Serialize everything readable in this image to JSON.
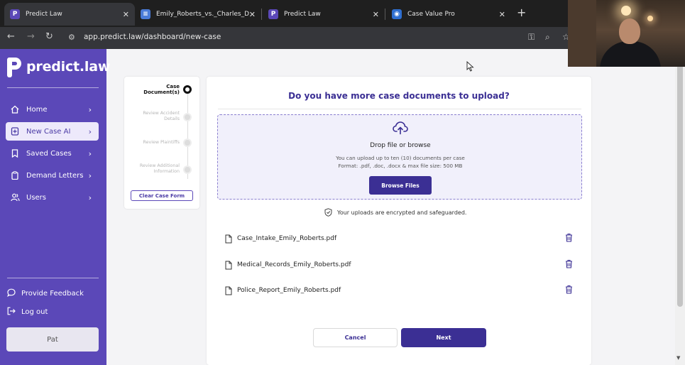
{
  "browser": {
    "tabs": [
      {
        "title": "Predict Law",
        "active": true
      },
      {
        "title": "Emily_Roberts_vs._Charles_D._M",
        "active": false
      },
      {
        "title": "Predict Law",
        "active": false
      },
      {
        "title": "Case Value Pro",
        "active": false
      }
    ],
    "url": "app.predict.law/dashboard/new-case"
  },
  "sidebar": {
    "logo": "predict.law",
    "items": [
      {
        "label": "Home",
        "icon": "home-icon",
        "active": false
      },
      {
        "label": "New Case AI",
        "icon": "new-case-icon",
        "active": true
      },
      {
        "label": "Saved Cases",
        "icon": "bookmark-icon",
        "active": false
      },
      {
        "label": "Demand Letters",
        "icon": "clipboard-icon",
        "active": false
      },
      {
        "label": "Users",
        "icon": "users-icon",
        "active": false
      }
    ],
    "feedback": "Provide Feedback",
    "logout": "Log out",
    "user": "Pat"
  },
  "stepper": {
    "steps": [
      {
        "label": "Case Document(s)",
        "current": true
      },
      {
        "label": "Review Accident Details",
        "current": false
      },
      {
        "label": "Review Plaintiffs",
        "current": false
      },
      {
        "label": "Review Additional Information",
        "current": false
      }
    ],
    "clear_label": "Clear Case Form"
  },
  "upload": {
    "heading": "Do you have more case documents to upload?",
    "drop_title": "Drop file or browse",
    "limit_text": "You can upload up to ten (10) documents per case",
    "format_text": "Format: .pdf, .doc, .docx & max file size: 500 MB",
    "browse_label": "Browse Files",
    "secure_text": "Your uploads are encrypted and safeguarded."
  },
  "files": [
    {
      "name": "Case_Intake_Emily_Roberts.pdf"
    },
    {
      "name": "Medical_Records_Emily_Roberts.pdf"
    },
    {
      "name": "Police_Report_Emily_Roberts.pdf"
    }
  ],
  "actions": {
    "cancel": "Cancel",
    "next": "Next"
  },
  "colors": {
    "sidebar": "#5b48b8",
    "primary": "#3b2f94",
    "dropzone_bg": "#f1f0fb"
  }
}
